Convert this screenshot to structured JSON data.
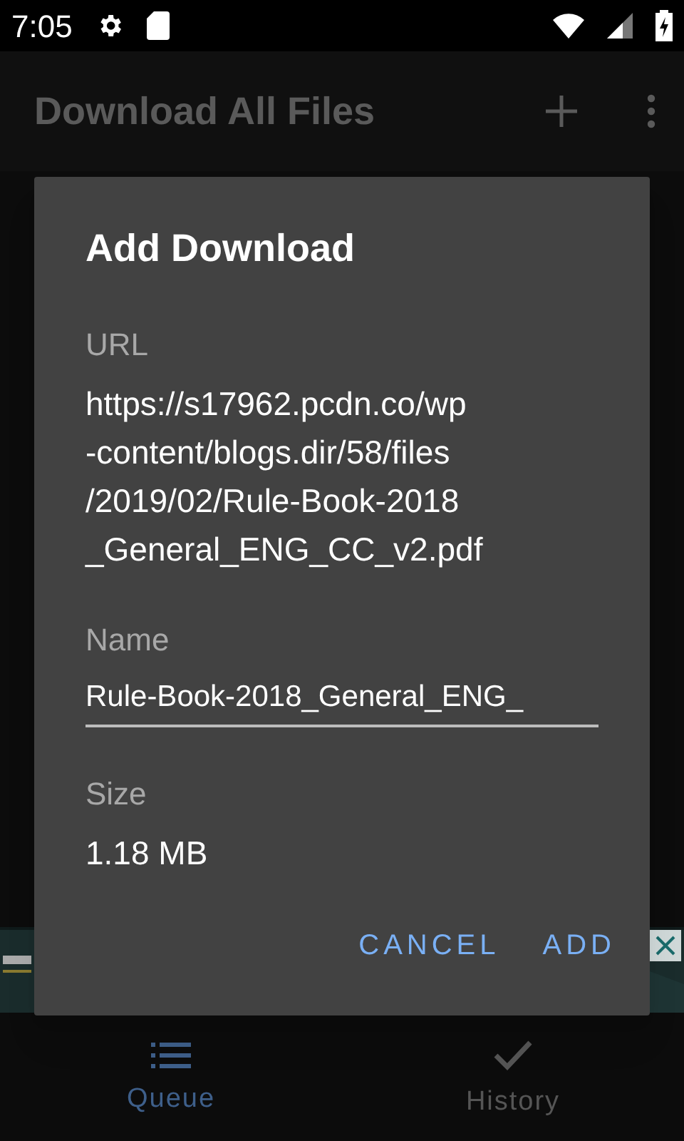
{
  "status_bar": {
    "time": "7:05"
  },
  "app_bar": {
    "title": "Download All Files"
  },
  "dialog": {
    "title": "Add Download",
    "fields": [
      {
        "kind": "text",
        "label": "URL",
        "lines": [
          "https://s17962.pcdn.co/wp",
          "-content/blogs.dir/58/files",
          "/2019/02/Rule-Book-2018",
          "_General_ENG_CC_v2.pdf"
        ]
      },
      {
        "kind": "input",
        "label": "Name",
        "value": "Rule-Book-2018_General_ENG_"
      },
      {
        "kind": "text",
        "label": "Size",
        "lines": [
          "1.18 MB"
        ]
      }
    ],
    "buttons": [
      "CANCEL",
      "ADD"
    ]
  },
  "bottom_nav": [
    {
      "label": "Queue",
      "kind": "list",
      "selected": true
    },
    {
      "label": "History",
      "kind": "check",
      "selected": false
    }
  ]
}
